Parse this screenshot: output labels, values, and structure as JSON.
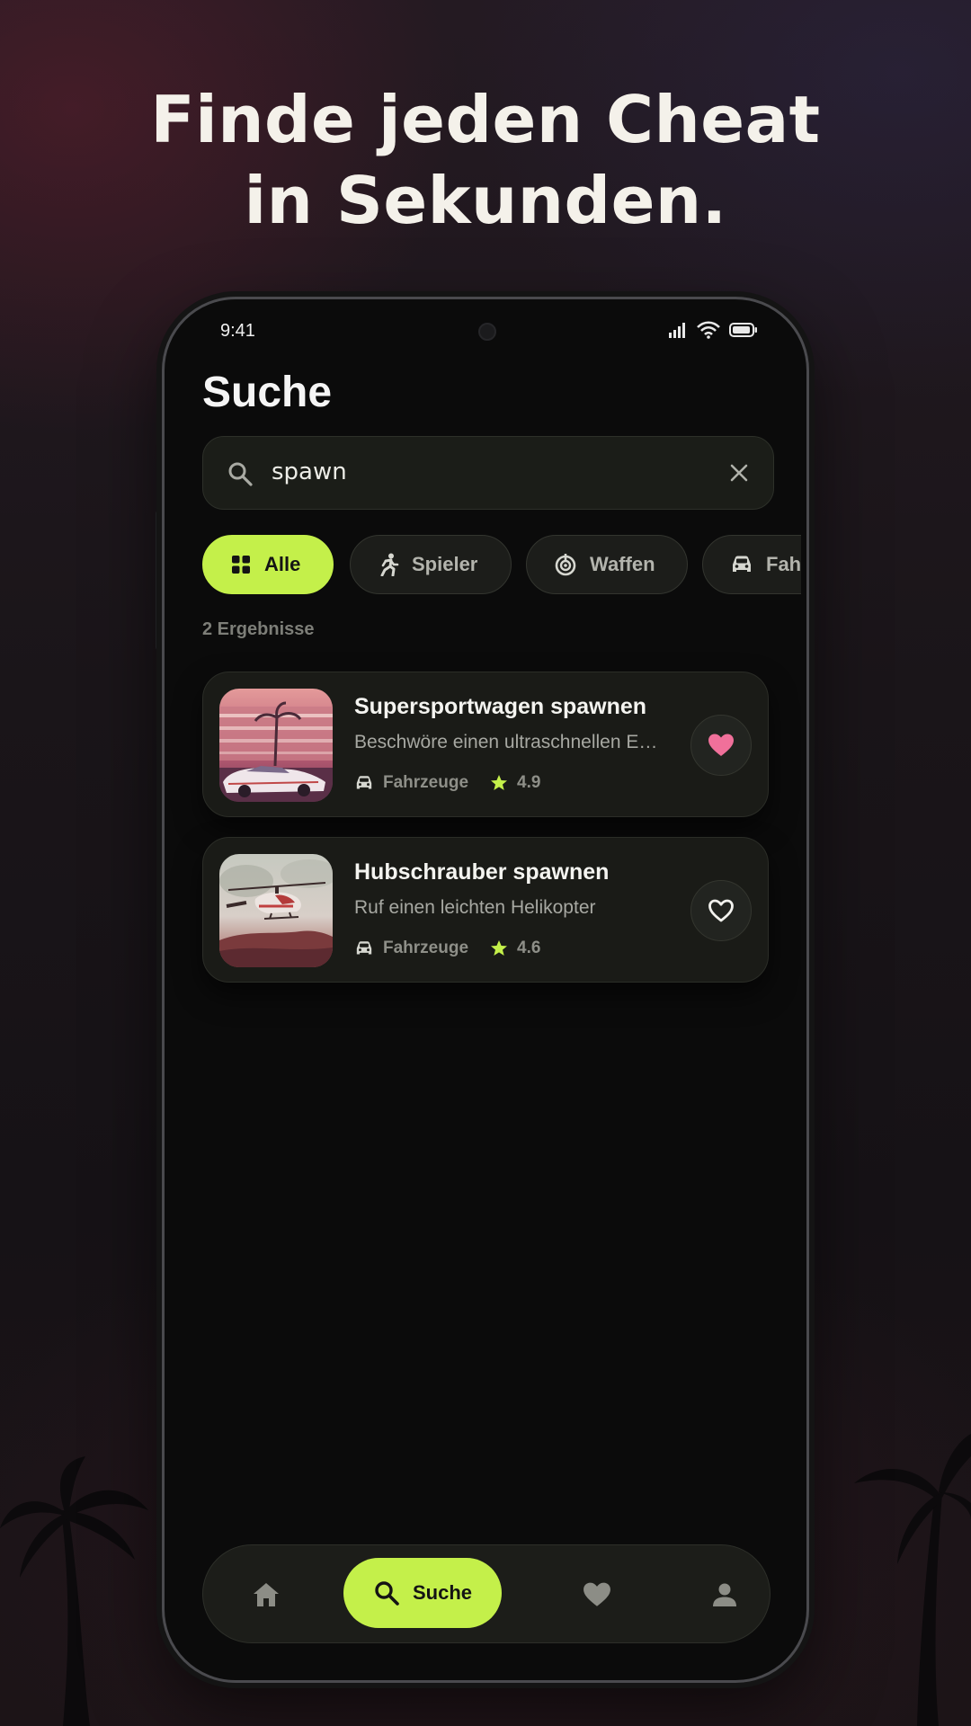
{
  "headline": {
    "line1": "Finde jeden Cheat",
    "line2": "in Sekunden."
  },
  "status_bar": {
    "time": "9:41",
    "icons": [
      "signal-icon",
      "wifi-icon",
      "battery-icon"
    ]
  },
  "page": {
    "title": "Suche"
  },
  "search": {
    "value": "spawn",
    "icon": "search-icon",
    "clear_icon": "close-icon"
  },
  "filters": [
    {
      "label": "Alle",
      "icon": "grid-icon",
      "active": true
    },
    {
      "label": "Spieler",
      "icon": "running-person-icon",
      "active": false
    },
    {
      "label": "Waffen",
      "icon": "target-icon",
      "active": false
    },
    {
      "label": "Fahrzeuge",
      "icon": "car-icon",
      "active": false
    }
  ],
  "results": {
    "count_label": "2 Ergebnisse",
    "items": [
      {
        "title": "Supersportwagen spawnen",
        "description": "Beschwöre einen ultraschnellen E…",
        "category": "Fahrzeuge",
        "rating": "4.9",
        "favorited": true
      },
      {
        "title": "Hubschrauber spawnen",
        "description": "Ruf einen leichten Helikopter",
        "category": "Fahrzeuge",
        "rating": "4.6",
        "favorited": false
      }
    ]
  },
  "bottom_nav": {
    "items": [
      {
        "icon": "home-icon",
        "label": ""
      },
      {
        "icon": "search-icon",
        "label": "Suche",
        "active": true
      },
      {
        "icon": "heart-icon",
        "label": ""
      },
      {
        "icon": "person-icon",
        "label": ""
      }
    ]
  },
  "colors": {
    "accent": "#c4f04a",
    "favorite": "#f0709a",
    "star": "#c4f04a",
    "background": "#0b0b0b"
  }
}
